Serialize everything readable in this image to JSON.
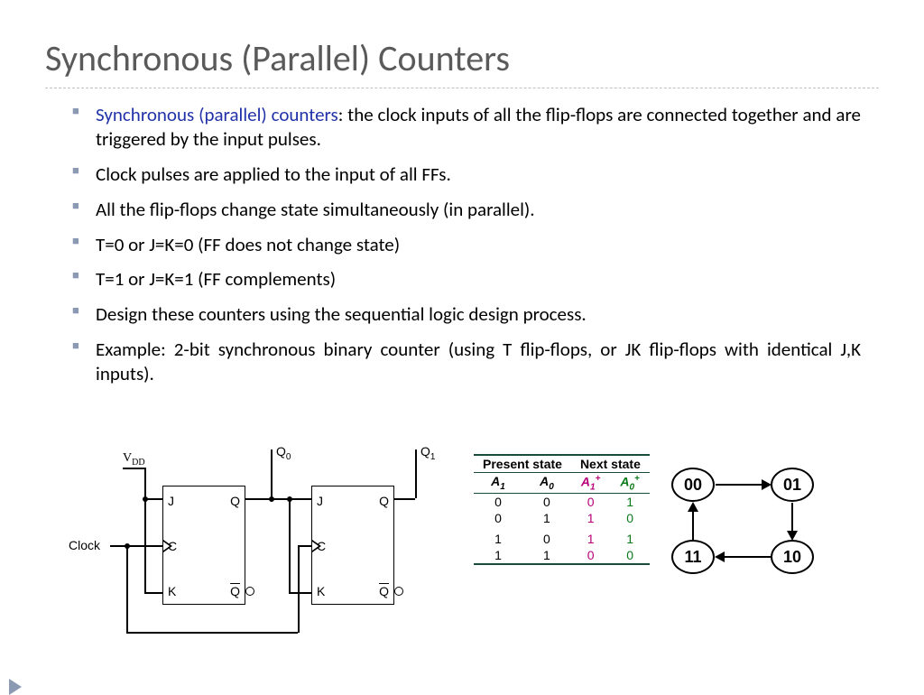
{
  "title": "Synchronous (Parallel) Counters",
  "bullets": [
    {
      "emph": "Synchronous (parallel) counters",
      "rest": ": the clock inputs of all the flip-flops are connected together and are triggered by the input pulses."
    },
    {
      "text": "Clock pulses are applied to the input of all FFs."
    },
    {
      "text": "All the flip-flops change state simultaneously (in parallel)."
    },
    {
      "text": "T=0 or J=K=0 (FF does not change state)"
    },
    {
      "text": "T=1 or J=K=1 (FF complements)"
    },
    {
      "text": "Design these counters using the sequential logic design process."
    },
    {
      "text": "Example: 2-bit synchronous binary counter (using T flip-flops, or JK flip-flops with identical J,K inputs)."
    }
  ],
  "circuit": {
    "labels": {
      "vdd_sub": "DD",
      "clock": "Clock",
      "q0_sub": "0",
      "q1_sub": "1"
    },
    "pins": {
      "J": "J",
      "K": "K",
      "C": "C",
      "Q": "Q",
      "Qbar": "Q"
    }
  },
  "table": {
    "headers": {
      "present": "Present state",
      "next": "Next state"
    },
    "cols": {
      "A": "A"
    },
    "rows": [
      [
        "0",
        "0",
        "0",
        "1"
      ],
      [
        "0",
        "1",
        "1",
        "0"
      ],
      [
        "1",
        "0",
        "1",
        "1"
      ],
      [
        "1",
        "1",
        "0",
        "0"
      ]
    ]
  },
  "stateDiagram": {
    "nodes": [
      "00",
      "01",
      "10",
      "11"
    ],
    "edges": [
      [
        "00",
        "01"
      ],
      [
        "01",
        "10"
      ],
      [
        "10",
        "11"
      ],
      [
        "11",
        "00"
      ]
    ]
  }
}
